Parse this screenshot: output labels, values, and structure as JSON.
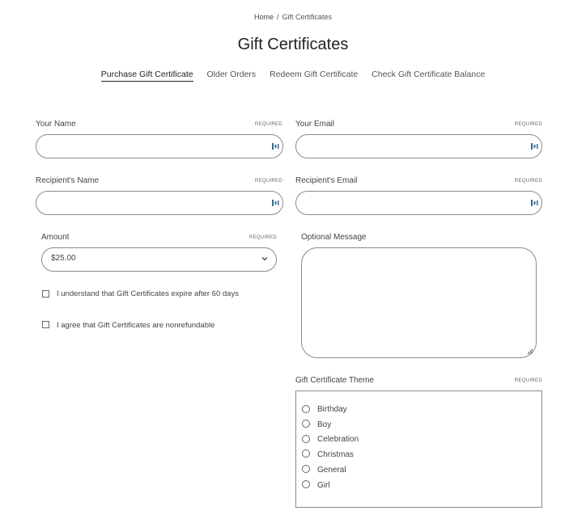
{
  "breadcrumb": {
    "home": "Home",
    "separator": "/",
    "current": "Gift Certificates"
  },
  "page_title": "Gift Certificates",
  "tabs": [
    {
      "label": "Purchase Gift Certificate",
      "active": true
    },
    {
      "label": "Older Orders",
      "active": false
    },
    {
      "label": "Redeem Gift Certificate",
      "active": false
    },
    {
      "label": "Check Gift Certificate Balance",
      "active": false
    }
  ],
  "required_text": "REQUIRED",
  "form": {
    "your_name": {
      "label": "Your Name",
      "value": ""
    },
    "your_email": {
      "label": "Your Email",
      "value": ""
    },
    "recipient_name": {
      "label": "Recipient's Name",
      "value": ""
    },
    "recipient_email": {
      "label": "Recipient's Email",
      "value": ""
    },
    "amount": {
      "label": "Amount",
      "value": "$25.00"
    },
    "optional_message": {
      "label": "Optional Message",
      "value": ""
    },
    "expire_checkbox": {
      "label": "I understand that Gift Certificates expire after 60 days",
      "checked": false
    },
    "nonrefund_checkbox": {
      "label": "I agree that Gift Certificates are nonrefundable",
      "checked": false
    },
    "theme": {
      "label": "Gift Certificate Theme",
      "options": [
        "Birthday",
        "Boy",
        "Celebration",
        "Christmas",
        "General",
        "Girl"
      ]
    }
  },
  "icons": {
    "field_autofill": "keyboard-autofill-icon",
    "select_chevron": "chevron-down-icon",
    "resize": "resize-grip-icon"
  },
  "colors": {
    "accent": "#2f6f8a",
    "border": "#8a8a8a",
    "text": "#3c3c3c"
  }
}
